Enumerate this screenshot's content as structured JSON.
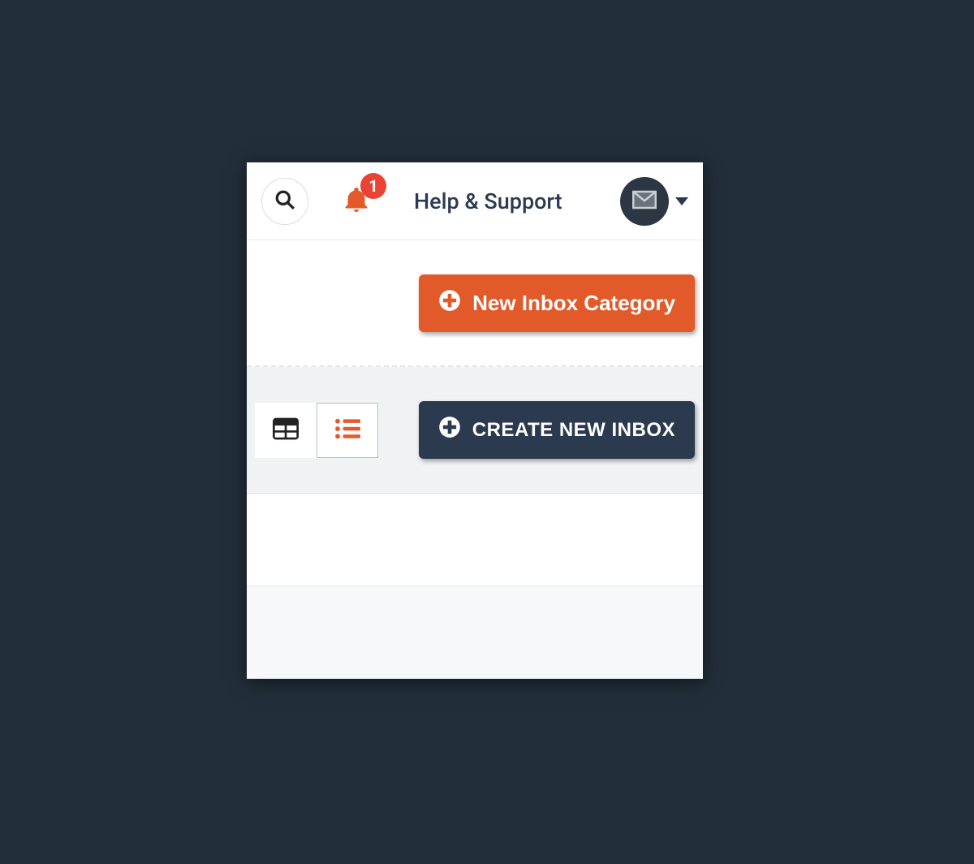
{
  "header": {
    "notification_count": "1",
    "help_label": "Help & Support"
  },
  "actions": {
    "new_category_label": "New Inbox Category",
    "create_inbox_label": "CREATE NEW INBOX"
  },
  "colors": {
    "accent_orange": "#e35a2a",
    "dark": "#2b3a4e",
    "badge_red": "#ea4335"
  }
}
